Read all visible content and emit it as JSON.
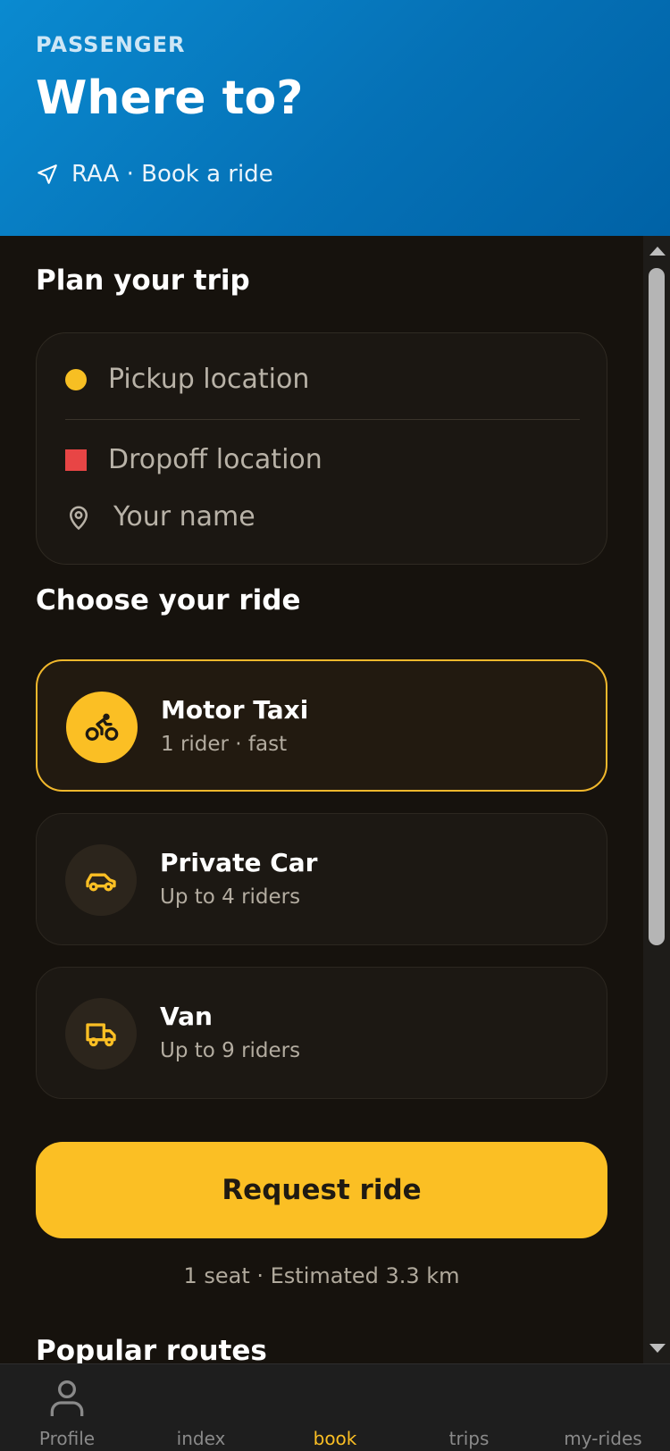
{
  "header": {
    "eyebrow": "PASSENGER",
    "title": "Where to?",
    "subtitle": "RAA · Book a ride"
  },
  "trip": {
    "section_title": "Plan your trip",
    "pickup_placeholder": "Pickup location",
    "dropoff_placeholder": "Dropoff location",
    "name_placeholder": "Your name"
  },
  "rides": {
    "section_title": "Choose your ride",
    "options": [
      {
        "name": "Motor Taxi",
        "desc": "1 rider · fast",
        "icon": "bike-icon",
        "selected": true
      },
      {
        "name": "Private Car",
        "desc": "Up to 4 riders",
        "icon": "car-icon",
        "selected": false
      },
      {
        "name": "Van",
        "desc": "Up to 9 riders",
        "icon": "truck-icon",
        "selected": false
      }
    ]
  },
  "request": {
    "button_label": "Request ride",
    "estimate": "1 seat · Estimated 3.3 km"
  },
  "popular": {
    "section_title": "Popular routes"
  },
  "tabs": [
    {
      "label": "Profile",
      "icon": "person-icon",
      "active": false
    },
    {
      "label": "index",
      "icon": "",
      "active": false
    },
    {
      "label": "book",
      "icon": "",
      "active": true
    },
    {
      "label": "trips",
      "icon": "",
      "active": false
    },
    {
      "label": "my-rides",
      "icon": "",
      "active": false
    }
  ],
  "colors": {
    "accent": "#fbbf24",
    "header_blue": "#0a7ec4",
    "background": "#16120d",
    "pickup_dot": "#f7bf23",
    "dropoff_square": "#e84545"
  }
}
